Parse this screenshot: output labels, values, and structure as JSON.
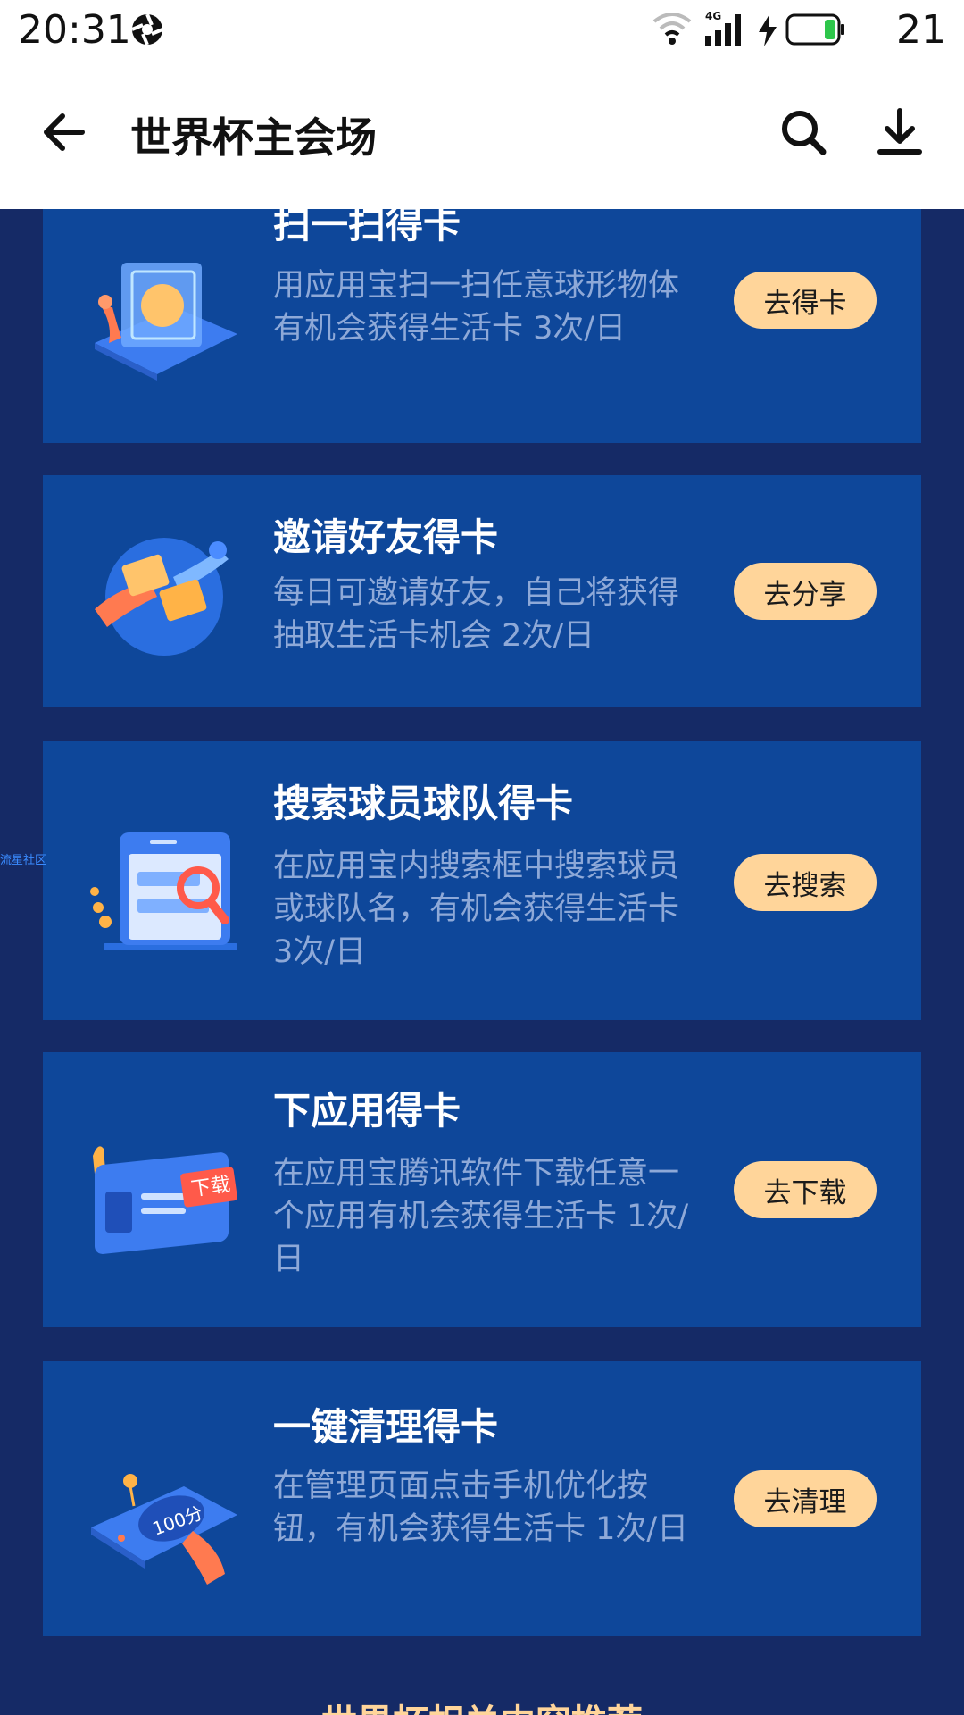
{
  "status_bar": {
    "time": "20:31",
    "battery": "21",
    "icons": [
      "aperture-icon",
      "wifi-icon",
      "signal-4g-icon",
      "charging-icon",
      "battery-icon"
    ]
  },
  "app_bar": {
    "title": "世界杯主会场",
    "icons": [
      "back-arrow-icon",
      "search-icon",
      "download-icon"
    ]
  },
  "tasks": [
    {
      "title": "扫一扫得卡",
      "desc": "用应用宝扫一扫任意球形物体 有机会获得生活卡 3次/日",
      "button": "去得卡",
      "icon": "scan-illustration"
    },
    {
      "title": "邀请好友得卡",
      "desc": "每日可邀请好友，自己将获得抽取生活卡机会 2次/日",
      "button": "去分享",
      "icon": "invite-illustration"
    },
    {
      "title": "搜索球员球队得卡",
      "desc": "在应用宝内搜索框中搜索球员或球队名，有机会获得生活卡 3次/日",
      "button": "去搜索",
      "icon": "search-illustration"
    },
    {
      "title": "下应用得卡",
      "desc": "在应用宝腾讯软件下载任意一个应用有机会获得生活卡 1次/日",
      "button": "去下载",
      "icon": "download-illustration",
      "badge": "下载"
    },
    {
      "title": "一键清理得卡",
      "desc": "在管理页面点击手机优化按钮，有机会获得生活卡 1次/日",
      "button": "去清理",
      "icon": "clean-illustration",
      "badge": "100分"
    }
  ],
  "watermark": "流星社区",
  "section_heading": "世界杯相关内容推荐",
  "colors": {
    "page_bg": "#152a66",
    "card_bg": "#0e479a",
    "button_bg": "#ffd59a",
    "heading": "#ffd59a",
    "desc_text": "#8ea9d8"
  }
}
